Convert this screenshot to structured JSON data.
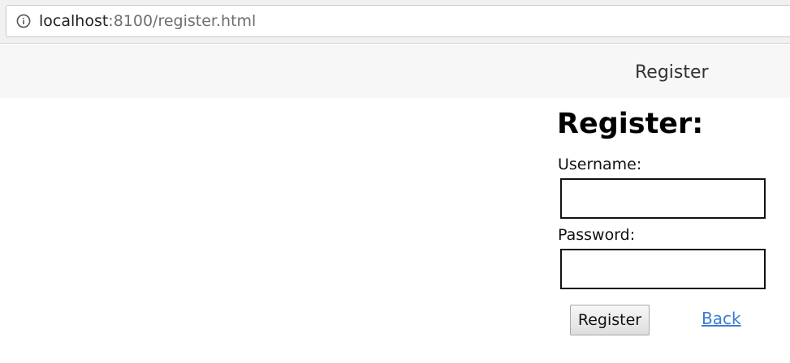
{
  "browser": {
    "url_host": "localhost",
    "url_rest": ":8100/register.html",
    "info_icon": "info-icon"
  },
  "header": {
    "title": "Register"
  },
  "form": {
    "heading": "Register:",
    "username_label": "Username:",
    "username_value": "",
    "password_label": "Password:",
    "password_value": "",
    "submit_label": "Register",
    "back_label": "Back"
  },
  "colors": {
    "link": "#3a7bd5",
    "header_bg": "#f7f7f7",
    "chrome_bg": "#f1f1f1"
  }
}
